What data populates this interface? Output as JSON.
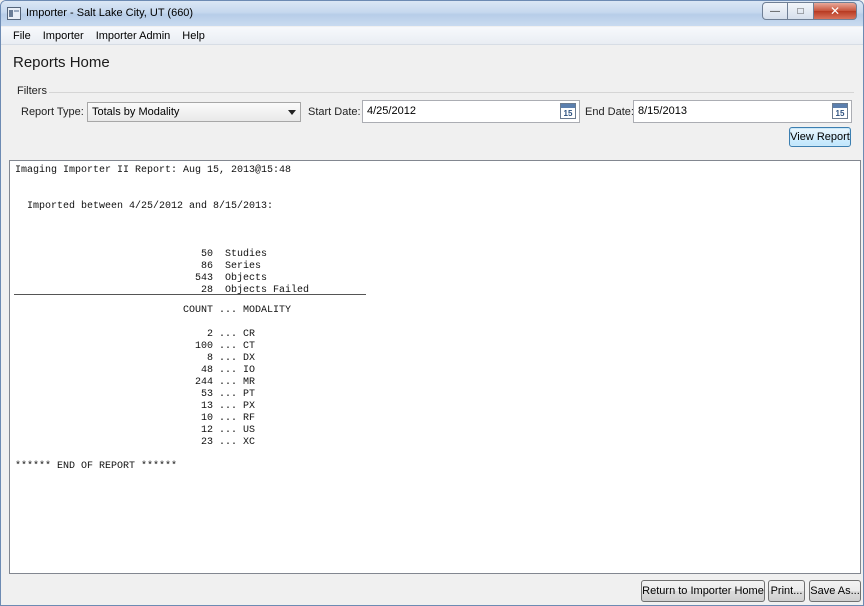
{
  "window": {
    "title": "Importer - Salt Lake City, UT (660)",
    "min_glyph": "—",
    "max_glyph": "□",
    "close_glyph": "✕"
  },
  "menu": [
    "File",
    "Importer",
    "Importer Admin",
    "Help"
  ],
  "page_title": "Reports Home",
  "filters": {
    "section_label": "Filters",
    "report_type_label": "Report Type:",
    "report_type_value": "Totals by Modality",
    "start_date_label": "Start Date:",
    "start_date_value": "4/25/2012",
    "end_date_label": "End Date:",
    "end_date_value": "8/15/2013",
    "calendar_day": "15",
    "view_button": "View Report"
  },
  "report": {
    "lines_top": [
      "Imaging Importer II Report: Aug 15, 2013@15:48",
      "",
      "",
      "  Imported between 4/25/2012 and 8/15/2013:",
      "",
      "",
      "",
      "                               50  Studies",
      "                               86  Series",
      "                              543  Objects",
      "                               28  Objects Failed"
    ],
    "lines_bottom": [
      "                            COUNT ... MODALITY",
      "",
      "                                2 ... CR",
      "                              100 ... CT",
      "                                8 ... DX",
      "                               48 ... IO",
      "                              244 ... MR",
      "                               53 ... PT",
      "                               13 ... PX",
      "                               10 ... RF",
      "                               12 ... US",
      "                               23 ... XC",
      "",
      "****** END OF REPORT ******"
    ]
  },
  "footer": {
    "return_button": "Return to Importer Home",
    "print_button": "Print...",
    "save_button": "Save As..."
  }
}
